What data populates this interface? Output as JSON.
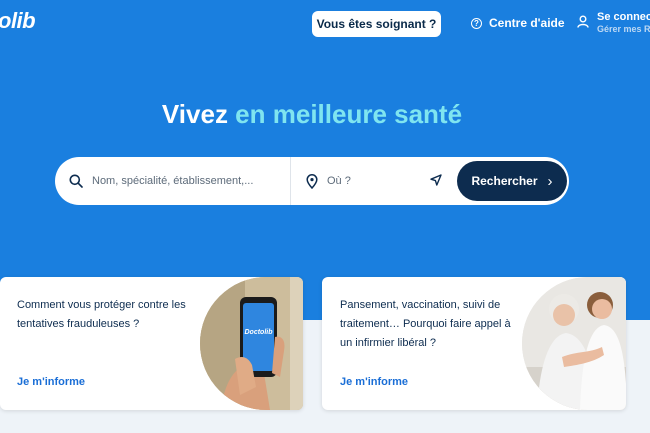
{
  "header": {
    "logo_text": "olib",
    "soignant_button": "Vous êtes soignant ?",
    "help_label": "Centre d'aide",
    "connect_title": "Se connec",
    "connect_subtitle": "Gérer mes R"
  },
  "hero": {
    "headline_part1": "Vivez ",
    "headline_part2": "en meilleure santé"
  },
  "search": {
    "what_placeholder": "Nom, spécialité, établissement,...",
    "where_placeholder": "Où ?",
    "submit_label": "Rechercher"
  },
  "cards": [
    {
      "text": "Comment vous protéger contre les tentatives frauduleuses ?",
      "link": "Je m'informe",
      "phone_brand": "Doctolib"
    },
    {
      "text": "Pansement, vaccination, suivi de traitement… Pourquoi faire appel à un infirmier libéral ?",
      "link": "Je m'informe"
    }
  ],
  "colors": {
    "hero_blue": "#1a7fdf",
    "accent_cyan": "#7fe5f0",
    "navy": "#0d2c4f",
    "link_blue": "#1a6ed6"
  }
}
